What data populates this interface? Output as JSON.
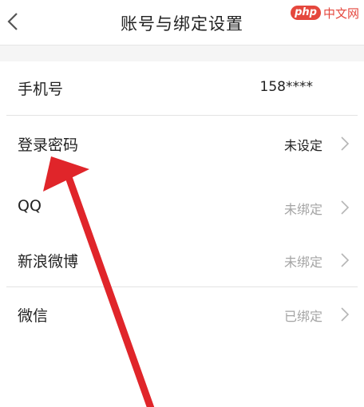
{
  "header": {
    "back_icon": "chevron-left-icon",
    "title": "账号与绑定设置"
  },
  "watermark": {
    "logo": "php",
    "text": "中文网"
  },
  "rows": [
    {
      "label": "手机号",
      "value": "158****",
      "arrow": false
    },
    {
      "label": "登录密码",
      "value": "未设定",
      "arrow": true
    },
    {
      "label": "QQ",
      "value": "未绑定",
      "arrow": true
    },
    {
      "label": "新浪微博",
      "value": "未绑定",
      "arrow": true
    },
    {
      "label": "微信",
      "value": "已绑定",
      "arrow": true
    }
  ],
  "colors": {
    "annotation_arrow": "#e0252a",
    "muted_text": "#a4a4a4",
    "divider": "#e3e3e3"
  }
}
